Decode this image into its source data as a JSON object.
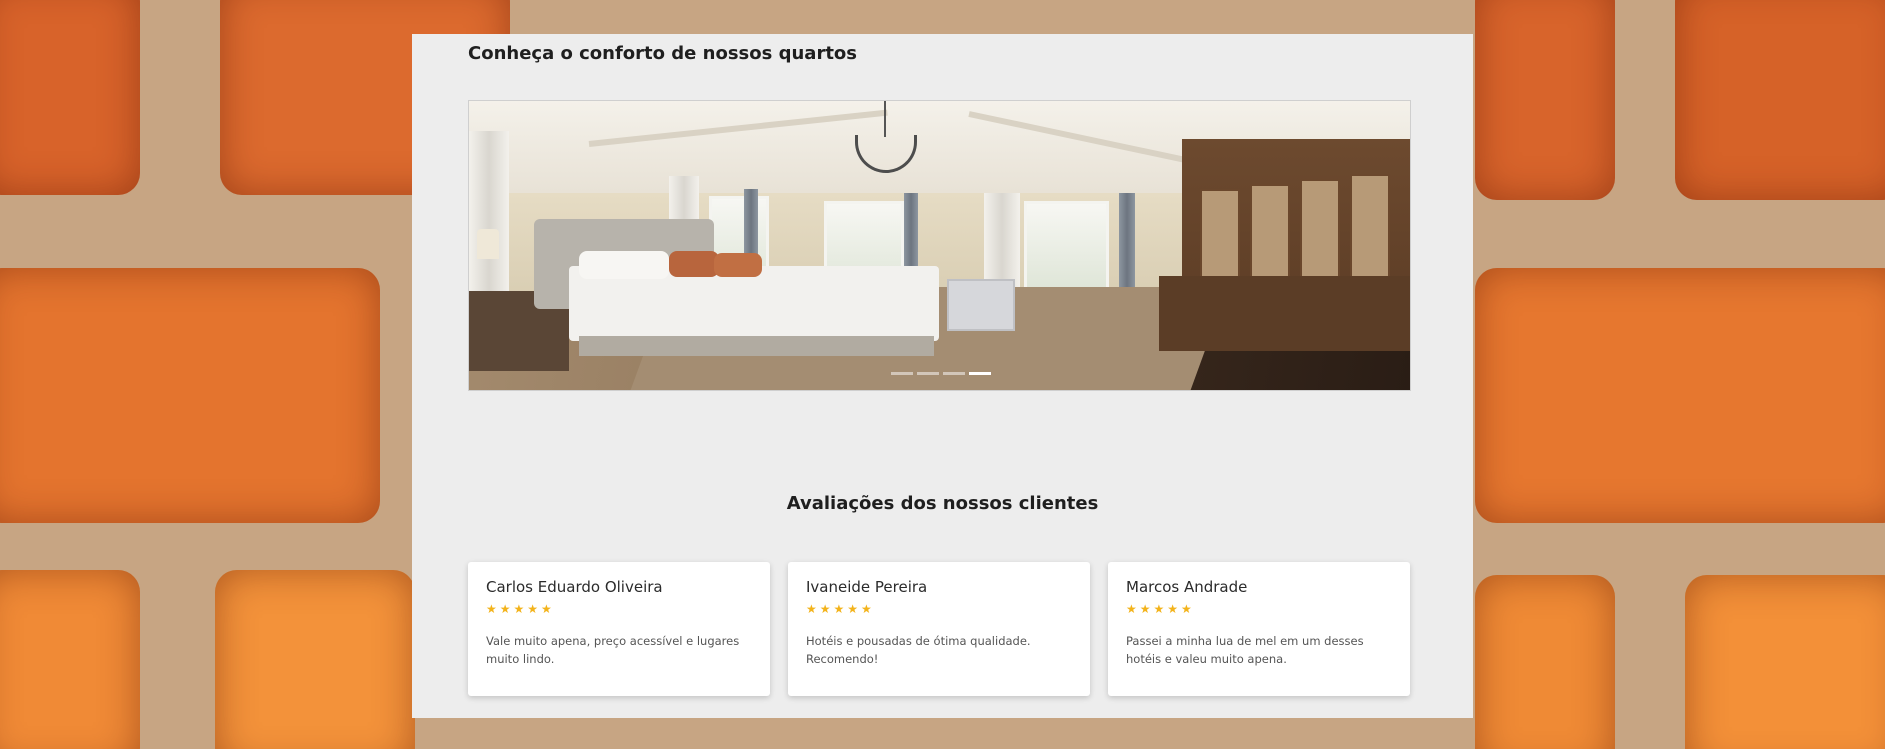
{
  "rooms_section": {
    "heading": "Conheça o conforto de nossos quartos",
    "carousel": {
      "image_alt_icon": "bedroom-photo",
      "slide_count": 4,
      "active_slide": 4
    }
  },
  "reviews_section": {
    "heading": "Avaliações dos nossos clientes",
    "star_color": "#f3b31b",
    "reviews": [
      {
        "name": "Carlos Eduardo Oliveira",
        "stars": "★★★★★",
        "rating": 5,
        "text": "Vale muito apena, preço acessível e lugares muito lindo."
      },
      {
        "name": "Ivaneide Pereira",
        "stars": "★★★★★",
        "rating": 5,
        "text": "Hotéis e pousadas de ótima qualidade. Recomendo!"
      },
      {
        "name": "Marcos Andrade",
        "stars": "★★★★★",
        "rating": 5,
        "text": "Passei a minha lua de mel em um desses hotéis e valeu muito apena."
      }
    ]
  },
  "colors": {
    "panel_background": "#ededed",
    "brick_background": "#e07a3a"
  }
}
